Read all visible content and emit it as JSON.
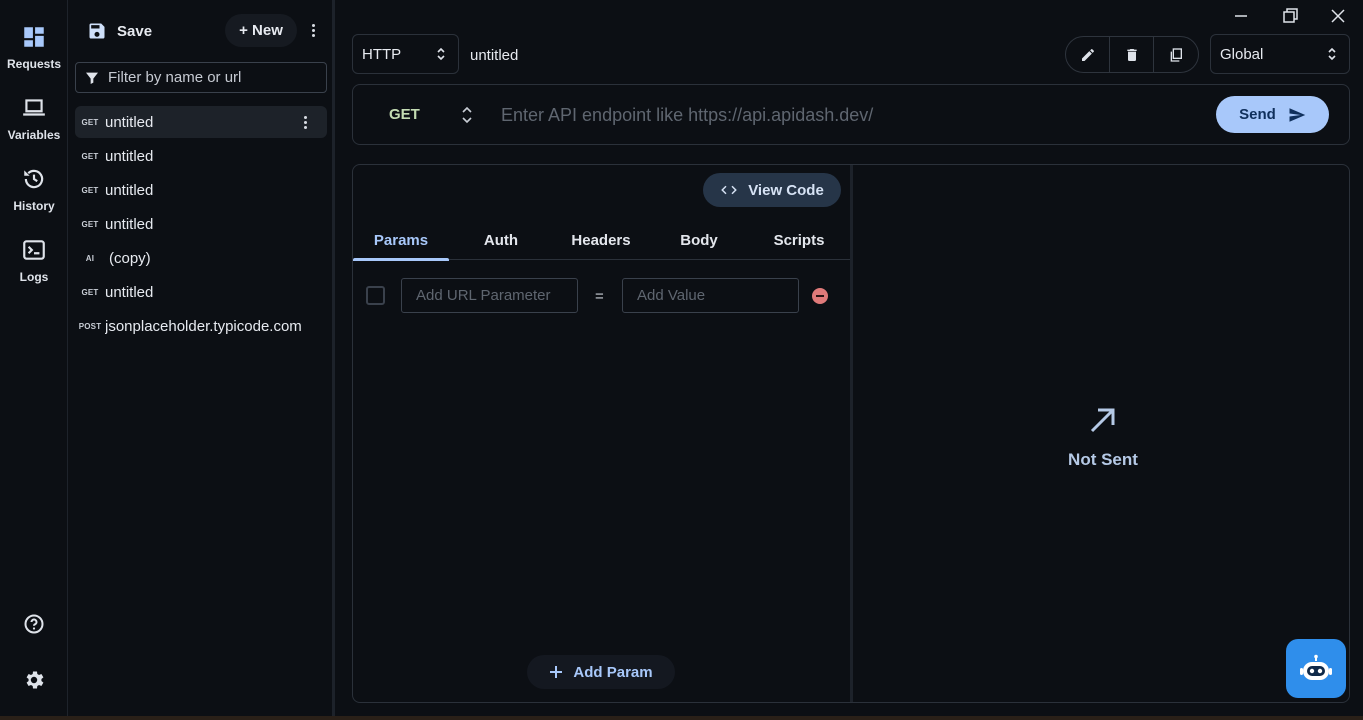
{
  "rail": {
    "items": [
      {
        "label": "Requests",
        "icon": "dashboard-icon"
      },
      {
        "label": "Variables",
        "icon": "laptop-icon"
      },
      {
        "label": "History",
        "icon": "history-icon"
      },
      {
        "label": "Logs",
        "icon": "terminal-icon"
      }
    ],
    "bottom": [
      {
        "icon": "help-icon"
      },
      {
        "icon": "gear-icon"
      }
    ]
  },
  "sidebar": {
    "save_label": "Save",
    "new_label": "+ New",
    "filter_placeholder": "Filter by name or url",
    "requests": [
      {
        "method": "GET",
        "name": "untitled",
        "selected": true
      },
      {
        "method": "GET",
        "name": "untitled"
      },
      {
        "method": "GET",
        "name": "untitled"
      },
      {
        "method": "GET",
        "name": "untitled"
      },
      {
        "method": "AI",
        "name": "(copy)"
      },
      {
        "method": "GET",
        "name": "untitled"
      },
      {
        "method": "POST",
        "name": "jsonplaceholder.typicode.com"
      }
    ]
  },
  "topbar": {
    "protocol": "HTTP",
    "request_name": "untitled",
    "environment": "Global"
  },
  "urlbar": {
    "method": "GET",
    "url_placeholder": "Enter API endpoint like https://api.apidash.dev/",
    "send_label": "Send"
  },
  "request_panel": {
    "view_code_label": "View Code",
    "tabs": [
      "Params",
      "Auth",
      "Headers",
      "Body",
      "Scripts"
    ],
    "active_tab": "Params",
    "param_row": {
      "key_placeholder": "Add URL Parameter",
      "equals": "=",
      "value_placeholder": "Add Value"
    },
    "add_param_label": "Add Param"
  },
  "response_panel": {
    "status_label": "Not Sent"
  },
  "colors": {
    "accent": "#a8c8fa",
    "background": "#0c0f14",
    "remove": "#e07a7a",
    "bot": "#2f8eeb"
  }
}
